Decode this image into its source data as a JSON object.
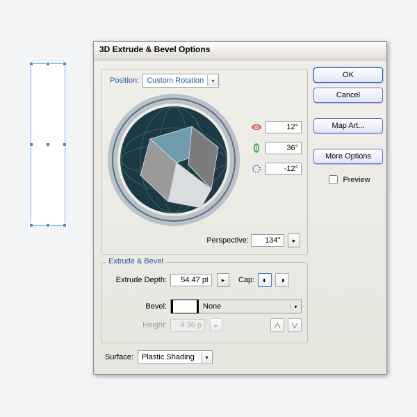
{
  "dialog": {
    "title": "3D Extrude & Bevel Options",
    "position": {
      "label": "Position:",
      "selected": "Custom Rotation",
      "angles": {
        "x": "12°",
        "y": "36°",
        "z": "-12°"
      },
      "perspective": {
        "label": "Perspective:",
        "value": "134°"
      }
    },
    "extrude": {
      "group_title": "Extrude & Bevel",
      "depth_label": "Extrude Depth:",
      "depth_value": "54.47 pt",
      "cap_label": "Cap:",
      "bevel_label": "Bevel:",
      "bevel_value": "None",
      "height_label": "Height:",
      "height_value": "4.36 p"
    },
    "surface": {
      "label": "Surface:",
      "selected": "Plastic Shading"
    }
  },
  "buttons": {
    "ok": "OK",
    "cancel": "Cancel",
    "map": "Map Art...",
    "more": "More Options"
  },
  "preview_label": "Preview"
}
